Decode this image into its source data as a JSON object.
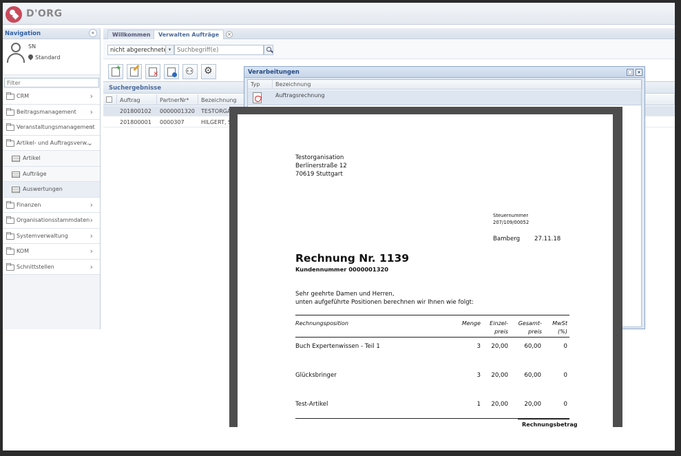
{
  "top_bleed_text": "",
  "brand": "D'ORG",
  "navigation": {
    "title": "Navigation",
    "collapse_glyph": "«",
    "user_name": "SN",
    "user_role": "Standard",
    "filter_placeholder": "Filter",
    "items": [
      {
        "label": "CRM",
        "type": "folder",
        "chevron": "›"
      },
      {
        "label": "Beitragsmanagement",
        "type": "folder",
        "chevron": "›"
      },
      {
        "label": "Veranstaltungsmanagement",
        "type": "folder",
        "chevron": "›"
      },
      {
        "label": "Artikel- und Auftragsverw...",
        "type": "folder-open",
        "chevron": "⌄"
      },
      {
        "label": "Artikel",
        "type": "sub"
      },
      {
        "label": "Aufträge",
        "type": "sub"
      },
      {
        "label": "Auswertungen",
        "type": "sub"
      },
      {
        "label": "Finanzen",
        "type": "folder",
        "chevron": "›"
      },
      {
        "label": "Organisationsstammdaten",
        "type": "folder",
        "chevron": "›"
      },
      {
        "label": "Systemverwaltung",
        "type": "folder",
        "chevron": "›"
      },
      {
        "label": "KOM",
        "type": "folder",
        "chevron": "›"
      },
      {
        "label": "Schnittstellen",
        "type": "folder",
        "chevron": "›"
      }
    ]
  },
  "tabs": [
    {
      "label": "Willkommen"
    },
    {
      "label": "Verwalten Aufträge",
      "close": "×"
    }
  ],
  "search": {
    "status_value": "nicht abgerechnete",
    "dropdown_glyph": "▾",
    "placeholder": "Suchbegriff(e)"
  },
  "toolbar_icons": [
    "new-document-icon",
    "edit-document-icon",
    "delete-document-icon",
    "document-info-icon",
    "binoculars-icon",
    "settings-gears-icon"
  ],
  "results": {
    "title": "Suchergebnisse",
    "columns": [
      "Auftrag",
      "PartnerNr*",
      "Bezeichnung"
    ],
    "rows": [
      {
        "auftrag": "201800102",
        "partner": "0000001320",
        "bezeichnung": "TESTORGAN"
      },
      {
        "auftrag": "201800001",
        "partner": "0000307",
        "bezeichnung": "HILGERT, SI"
      }
    ]
  },
  "dialog": {
    "title": "Verarbeitungen",
    "btn_max": "□",
    "btn_close": "×",
    "col_typ": "Typ",
    "col_bez": "Bezeichnung",
    "row_label": "Auftragsrechnung"
  },
  "invoice": {
    "sender": [
      "Testorganisation",
      "Berlinerstraße 12",
      "70619 Stuttgart"
    ],
    "tax_label": "Steuernummer",
    "tax_number": "207/109/00052",
    "city": "Bamberg",
    "date": "27.11.18",
    "title": "Rechnung Nr.  1139",
    "customer": "Kundennummer  0000001320",
    "salutation": "Sehr geehrte Damen und Herren,",
    "intro": "unten aufgeführte Positionen berechnen wir Ihnen wie folgt:",
    "headers": {
      "position": "Rechnungsposition",
      "qty": "Menge",
      "unit_1": "Einzel-",
      "unit_2": "preis",
      "total_1": "Gesamt-",
      "total_2": "preis",
      "vat_1": "MwSt",
      "vat_2": "(%)"
    },
    "lines": [
      {
        "name": "Buch Expertenwissen - Teil 1",
        "qty": "3",
        "unit": "20,00",
        "total": "60,00",
        "vat": "0"
      },
      {
        "name": "Glücksbringer",
        "qty": "3",
        "unit": "20,00",
        "total": "60,00",
        "vat": "0"
      },
      {
        "name": "Test-Artikel",
        "qty": "1",
        "unit": "20,00",
        "total": "20,00",
        "vat": "0"
      }
    ],
    "total_label": "Rechnungsbetrag"
  },
  "bottom_bleed_text": ""
}
